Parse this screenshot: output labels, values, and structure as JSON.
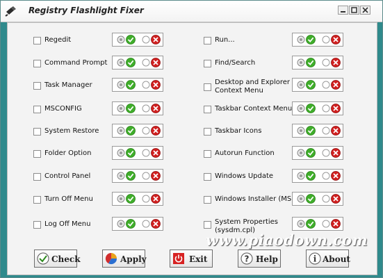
{
  "window": {
    "title": "Registry Flashlight Fixer"
  },
  "options_left": [
    {
      "label": "Regedit"
    },
    {
      "label": "Command Prompt"
    },
    {
      "label": "Task Manager"
    },
    {
      "label": "MSCONFIG"
    },
    {
      "label": "System Restore"
    },
    {
      "label": "Folder Option"
    },
    {
      "label": "Control Panel"
    },
    {
      "label": "Turn Off Menu"
    },
    {
      "label": "Log Off Menu"
    }
  ],
  "options_right": [
    {
      "label": "Run..."
    },
    {
      "label": "Find/Search"
    },
    {
      "label_line1": "Desktop and Explorer",
      "label_line2": "Context Menu"
    },
    {
      "label": "Taskbar Context Menu"
    },
    {
      "label": "Taskbar Icons"
    },
    {
      "label": "Autorun Function"
    },
    {
      "label": "Windows Update"
    },
    {
      "label": "Windows Installer (MSI)"
    },
    {
      "label_line1": "System Properties",
      "label_line2": "(sysdm.cpl)"
    }
  ],
  "buttons": {
    "check": "Check",
    "apply": "Apply",
    "exit": "Exit",
    "help": "Help",
    "about": "About"
  },
  "watermark": "www.piaodown.com",
  "icons": {
    "enable": "check-green-icon",
    "disable": "cross-red-icon",
    "radio": "radio-icon"
  },
  "colors": {
    "frame": "#2f8a8c",
    "enable_green": "#3fae2a",
    "disable_red": "#d11f1f"
  }
}
